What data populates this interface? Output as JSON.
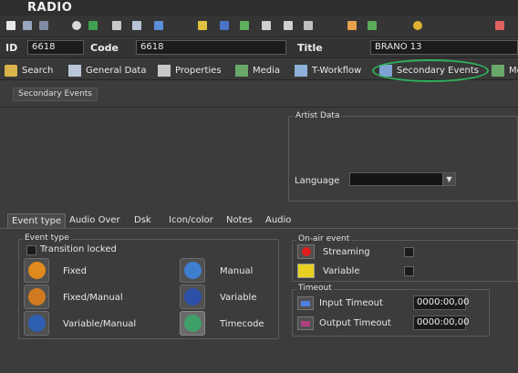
{
  "app": {
    "title": "RADIO"
  },
  "toolbar": {
    "icons": [
      "new-doc-icon",
      "save-icon",
      "save-all-icon",
      "undo-icon",
      "spreadsheet-icon",
      "copy-icon",
      "network-icon",
      "tools-icon",
      "effects-icon",
      "stack-icon",
      "schedule-icon",
      "dog-icon",
      "window-icon",
      "preview-icon",
      "document-icon",
      "media-icon",
      "globe-icon",
      "calendar-icon"
    ]
  },
  "header": {
    "id_label": "ID",
    "id_value": "6618",
    "code_label": "Code",
    "code_value": "6618",
    "title_label": "Title",
    "title_value": "BRANO 13"
  },
  "nav": {
    "tabs": [
      {
        "label": "Search"
      },
      {
        "label": "General Data"
      },
      {
        "label": "Properties"
      },
      {
        "label": "Media"
      },
      {
        "label": "T-Workflow"
      },
      {
        "label": "Secondary Events"
      },
      {
        "label": "Me"
      }
    ],
    "highlight_color": "#2fb25a"
  },
  "secondary": {
    "subtab_label": "Secondary Events",
    "artist_data_title": "Artist Data",
    "language_label": "Language",
    "language_value": ""
  },
  "inner_tabs": [
    "Event type",
    "Audio Over",
    "Dsk",
    "Icon/color",
    "Notes",
    "Audio"
  ],
  "event_type": {
    "title": "Event type",
    "transition_locked": "Transition locked",
    "buttons": [
      {
        "label": "Fixed"
      },
      {
        "label": "Fixed/Manual"
      },
      {
        "label": "Variable/Manual"
      },
      {
        "label": "Manual"
      },
      {
        "label": "Variable"
      },
      {
        "label": "Timecode"
      }
    ]
  },
  "on_air": {
    "title": "On-air event",
    "streaming": "Streaming",
    "variable": "Variable"
  },
  "timeout": {
    "title": "Timeout",
    "input_label": "Input Timeout",
    "input_value": "0000:00,00",
    "output_label": "Output Timeout",
    "output_value": "0000:00,00"
  },
  "colors": {
    "background": "#3c3c3c",
    "accent_green": "#2fb25a"
  }
}
